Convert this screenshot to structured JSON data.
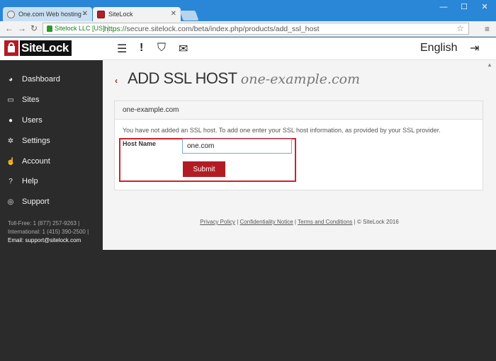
{
  "browser": {
    "tabs": [
      {
        "title": "One.com Web hosting - ",
        "active": false
      },
      {
        "title": "SiteLock",
        "active": true
      }
    ],
    "ev_label": "Sitelock LLC [US]",
    "url_scheme": "https://",
    "url_rest": "secure.sitelock.com/beta/index.php/products/add_ssl_host"
  },
  "brand": {
    "name": "SiteLock"
  },
  "topnav": {
    "language": "English"
  },
  "sidebar": {
    "items": [
      {
        "label": "Dashboard",
        "icon": "dashboard-icon"
      },
      {
        "label": "Sites",
        "icon": "monitor-icon"
      },
      {
        "label": "Users",
        "icon": "users-icon"
      },
      {
        "label": "Settings",
        "icon": "gear-icon"
      },
      {
        "label": "Account",
        "icon": "thumbs-up-icon"
      },
      {
        "label": "Help",
        "icon": "question-icon"
      },
      {
        "label": "Support",
        "icon": "lifebuoy-icon"
      }
    ],
    "contact": {
      "tollfree": "Toll-Free: 1 (877) 257-9263 |",
      "international": "International: 1 (415) 390-2500 |",
      "email": "Email: support@sitelock.com"
    }
  },
  "main": {
    "heading": "ADD SSL HOST",
    "domain": "one-example.com",
    "card_title": "one-example.com",
    "message": "You have not added an SSL host. To add one enter your SSL host information, as provided by your SSL provider.",
    "host_label": "Host Name",
    "host_value": "one.com",
    "submit_label": "Submit"
  },
  "footer": {
    "privacy": "Privacy Policy",
    "confidentiality": "Confidentiality Notice",
    "terms": "Terms and Conditions",
    "copyright": "© SiteLock 2016"
  },
  "colors": {
    "brand_red": "#b31b24",
    "sidebar_bg": "#2b2b2b",
    "highlight_border": "#d0202a"
  }
}
